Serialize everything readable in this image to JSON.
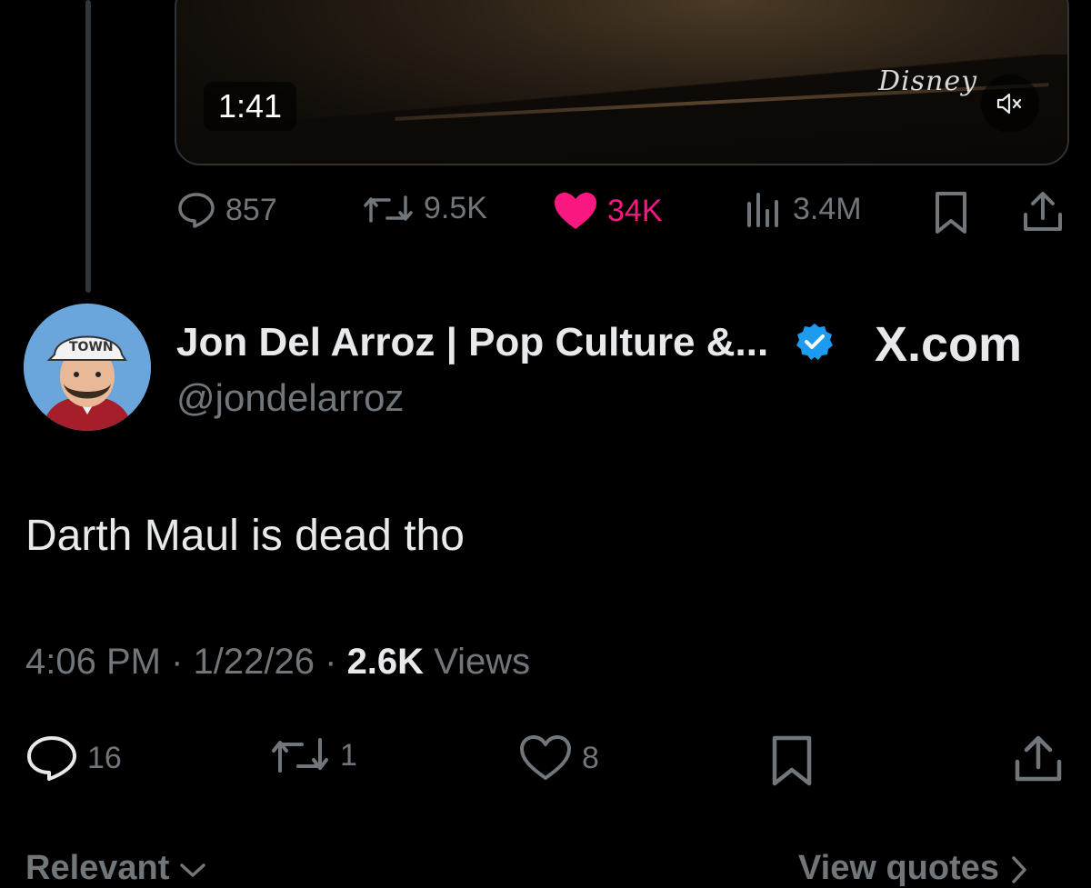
{
  "video": {
    "duration": "1:41",
    "watermark": "Disney"
  },
  "parent_actions": {
    "replies": "857",
    "reposts": "9.5K",
    "likes": "34K",
    "views": "3.4M",
    "liked": true
  },
  "author": {
    "display_name": "Jon Del Arroz | Pop Culture &...",
    "handle": "@jondelarroz",
    "verified": true,
    "source_label": "X.com"
  },
  "tweet": {
    "text": "Darth Maul is dead tho",
    "time": "4:06 PM",
    "date": "1/22/26",
    "views_count": "2.6K",
    "views_label": "Views"
  },
  "tweet_actions": {
    "replies": "16",
    "reposts": "1",
    "likes": "8"
  },
  "footer": {
    "sort_label": "Relevant",
    "quotes_label": "View quotes"
  },
  "colors": {
    "background": "#000000",
    "secondary_text": "#71767b",
    "like_pink": "#f91880",
    "verified_blue": "#1d9bf0"
  }
}
